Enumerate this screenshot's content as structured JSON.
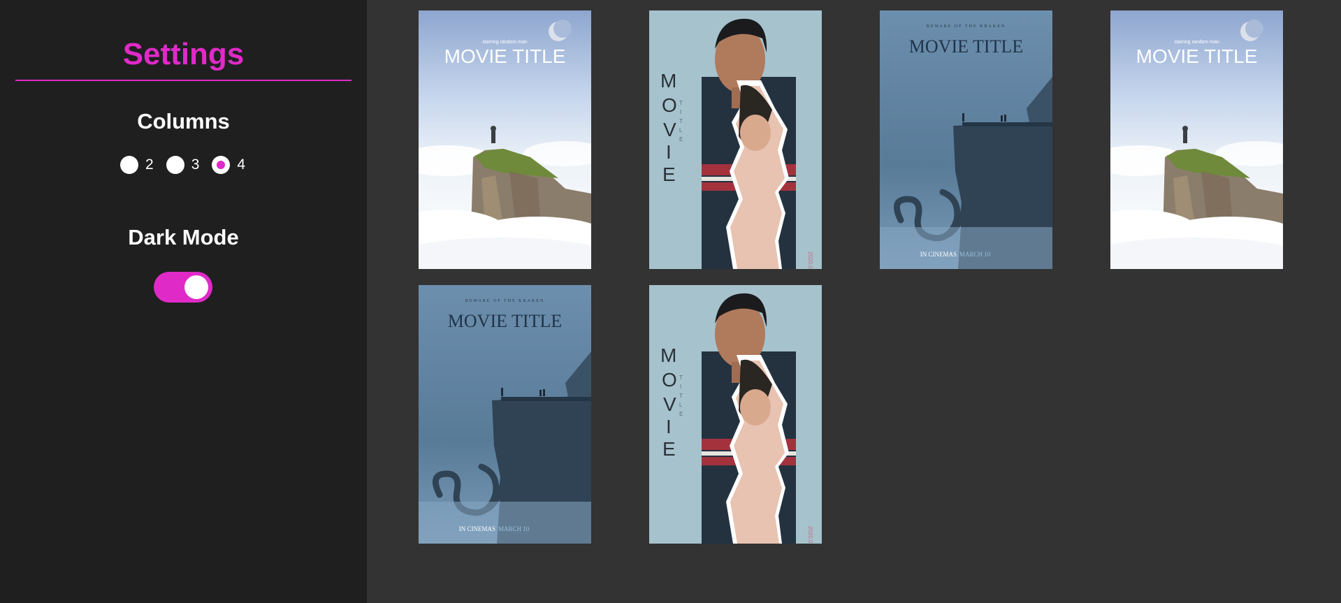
{
  "sidebar": {
    "title": "Settings",
    "columns": {
      "heading": "Columns",
      "options": [
        {
          "label": "2",
          "checked": false
        },
        {
          "label": "3",
          "checked": false
        },
        {
          "label": "4",
          "checked": true
        }
      ]
    },
    "dark_mode": {
      "heading": "Dark Mode",
      "enabled": true
    }
  },
  "colors": {
    "accent": "#e02ac7",
    "sidebar_bg": "#1f1f1f",
    "main_bg": "#333333"
  },
  "posters": [
    {
      "style": "cliff-clouds",
      "tagline": "starring random man",
      "title": "MOVIE TITLE"
    },
    {
      "style": "torn-portrait",
      "title": "MOVIE",
      "subtitle": "TITLE",
      "date": "2020.03"
    },
    {
      "style": "kraken",
      "tagline": "BEWARE OF THE KRAKEN",
      "title": "MOVIE TITLE",
      "footer_a": "IN CINEMAS",
      "footer_b": "MARCH 10"
    },
    {
      "style": "cliff-clouds",
      "tagline": "starring random man",
      "title": "MOVIE TITLE"
    },
    {
      "style": "kraken",
      "tagline": "BEWARE OF THE KRAKEN",
      "title": "MOVIE TITLE",
      "footer_a": "IN CINEMAS",
      "footer_b": "MARCH 10"
    },
    {
      "style": "torn-portrait",
      "title": "MOVIE",
      "subtitle": "TITLE",
      "date": "2020.03"
    }
  ]
}
